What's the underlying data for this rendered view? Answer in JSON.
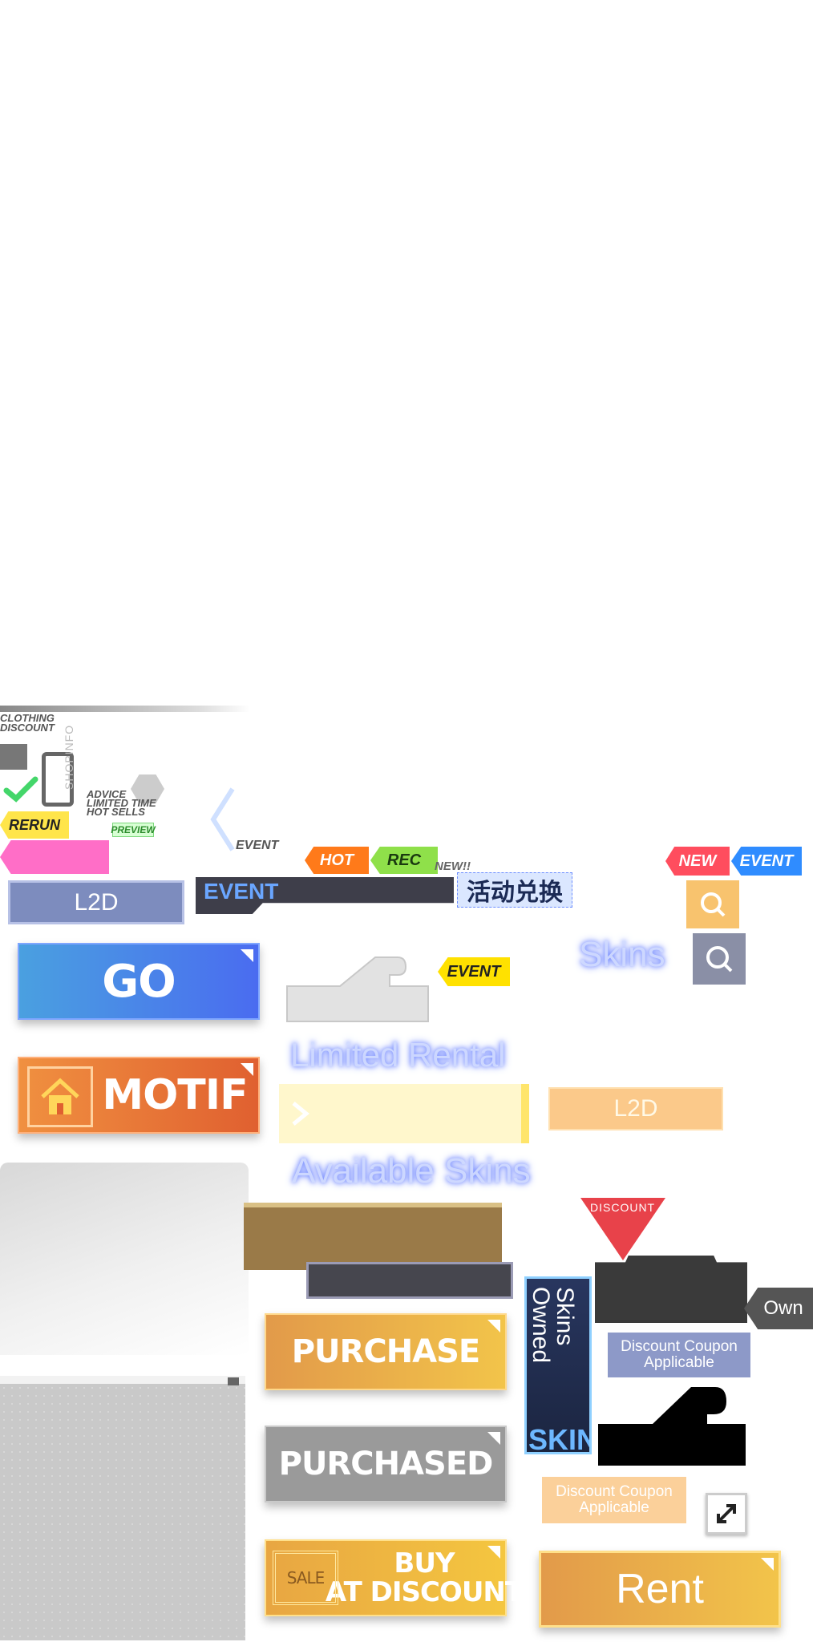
{
  "colors": {
    "go_blue": "#4a78f0",
    "motif_orange": "#e86a3a",
    "purchase_gold": "#e9a84b",
    "purchased_gray": "#9a9a9a",
    "hot_orange": "#ff7a1a",
    "rec_green": "#8fe04a",
    "new_red": "#ff4d5e",
    "event_blue": "#2f8cff",
    "event_yellow": "#ffe100",
    "rerun_yellow": "#ffe54a",
    "discount_red": "#e8424a"
  },
  "top_left": {
    "clothing_discount": "CLOTHING\nDISCOUNT",
    "shopinfo": "SHOPINFO",
    "advice": "ADVICE",
    "limited_time": "LIMITED TIME",
    "hot_sells": "HOT SELLS",
    "rerun": "RERUN",
    "preview": "PREVIEW"
  },
  "tags": {
    "event_small": "EVENT",
    "hot": "HOT",
    "rec": "REC",
    "new_plain": "NEW!!",
    "new": "NEW",
    "event_blue": "EVENT",
    "event_yellow": "EVENT",
    "exchange": "活动兑换"
  },
  "banners": {
    "l2d_blue": "L2D",
    "event_bar": "EVENT",
    "l2d_orange": "L2D",
    "skins": "Skins",
    "limited_rental": "Limited Rental",
    "available_skins": "Available Skins"
  },
  "buttons": {
    "go": "GO",
    "motif": "MOTIF",
    "purchase": "PURCHASE",
    "purchased": "PURCHASED",
    "buy_at_discount": "BUY\nAT DISCOUNT",
    "sale": "SALE",
    "rent": "Rent"
  },
  "badges": {
    "discount": "DISCOUNT",
    "own": "Own",
    "discount_coupon_1": "Discount Coupon\nApplicable",
    "discount_coupon_2": "Discount Coupon\nApplicable",
    "skins_owned": "Skins\nOwned",
    "skins_watermark": "SKINS"
  },
  "icons": [
    "search-icon",
    "home-icon",
    "check-icon",
    "expand-icon",
    "chevron-left-icon",
    "chevron-right-icon"
  ]
}
